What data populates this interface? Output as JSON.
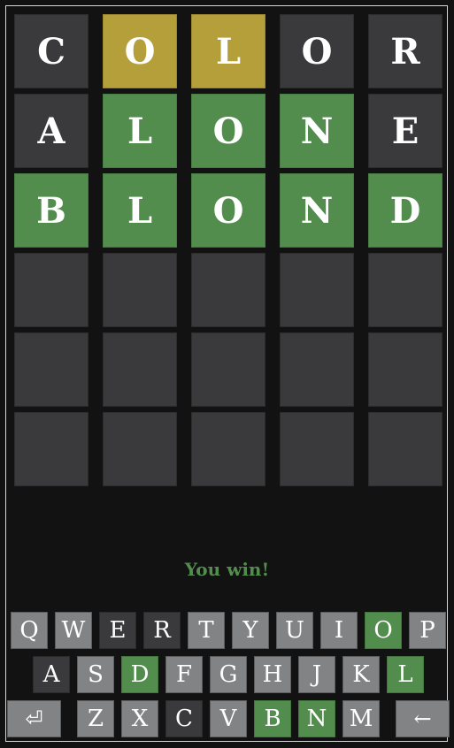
{
  "board": [
    [
      {
        "l": "C",
        "s": "absent"
      },
      {
        "l": "O",
        "s": "present"
      },
      {
        "l": "L",
        "s": "present"
      },
      {
        "l": "O",
        "s": "absent"
      },
      {
        "l": "R",
        "s": "absent"
      }
    ],
    [
      {
        "l": "A",
        "s": "absent"
      },
      {
        "l": "L",
        "s": "correct"
      },
      {
        "l": "O",
        "s": "correct"
      },
      {
        "l": "N",
        "s": "correct"
      },
      {
        "l": "E",
        "s": "absent"
      }
    ],
    [
      {
        "l": "B",
        "s": "correct"
      },
      {
        "l": "L",
        "s": "correct"
      },
      {
        "l": "O",
        "s": "correct"
      },
      {
        "l": "N",
        "s": "correct"
      },
      {
        "l": "D",
        "s": "correct"
      }
    ],
    [
      {
        "l": "",
        "s": "empty"
      },
      {
        "l": "",
        "s": "empty"
      },
      {
        "l": "",
        "s": "empty"
      },
      {
        "l": "",
        "s": "empty"
      },
      {
        "l": "",
        "s": "empty"
      }
    ],
    [
      {
        "l": "",
        "s": "empty"
      },
      {
        "l": "",
        "s": "empty"
      },
      {
        "l": "",
        "s": "empty"
      },
      {
        "l": "",
        "s": "empty"
      },
      {
        "l": "",
        "s": "empty"
      }
    ],
    [
      {
        "l": "",
        "s": "empty"
      },
      {
        "l": "",
        "s": "empty"
      },
      {
        "l": "",
        "s": "empty"
      },
      {
        "l": "",
        "s": "empty"
      },
      {
        "l": "",
        "s": "empty"
      }
    ]
  ],
  "message": "You win!",
  "keyboard": [
    [
      {
        "k": "Q",
        "s": "unused"
      },
      {
        "k": "W",
        "s": "unused"
      },
      {
        "k": "E",
        "s": "absent"
      },
      {
        "k": "R",
        "s": "absent"
      },
      {
        "k": "T",
        "s": "unused"
      },
      {
        "k": "Y",
        "s": "unused"
      },
      {
        "k": "U",
        "s": "unused"
      },
      {
        "k": "I",
        "s": "unused"
      },
      {
        "k": "O",
        "s": "correct"
      },
      {
        "k": "P",
        "s": "unused"
      }
    ],
    [
      {
        "k": "A",
        "s": "absent"
      },
      {
        "k": "S",
        "s": "unused"
      },
      {
        "k": "D",
        "s": "correct"
      },
      {
        "k": "F",
        "s": "unused"
      },
      {
        "k": "G",
        "s": "unused"
      },
      {
        "k": "H",
        "s": "unused"
      },
      {
        "k": "J",
        "s": "unused"
      },
      {
        "k": "K",
        "s": "unused"
      },
      {
        "k": "L",
        "s": "correct"
      }
    ],
    [
      {
        "k": "⏎",
        "s": "unused",
        "name": "enter-key"
      },
      {
        "k": "Z",
        "s": "unused"
      },
      {
        "k": "X",
        "s": "unused"
      },
      {
        "k": "C",
        "s": "absent"
      },
      {
        "k": "V",
        "s": "unused"
      },
      {
        "k": "B",
        "s": "correct"
      },
      {
        "k": "N",
        "s": "correct"
      },
      {
        "k": "M",
        "s": "unused"
      },
      {
        "k": "←",
        "s": "unused",
        "name": "backspace-key"
      }
    ]
  ]
}
